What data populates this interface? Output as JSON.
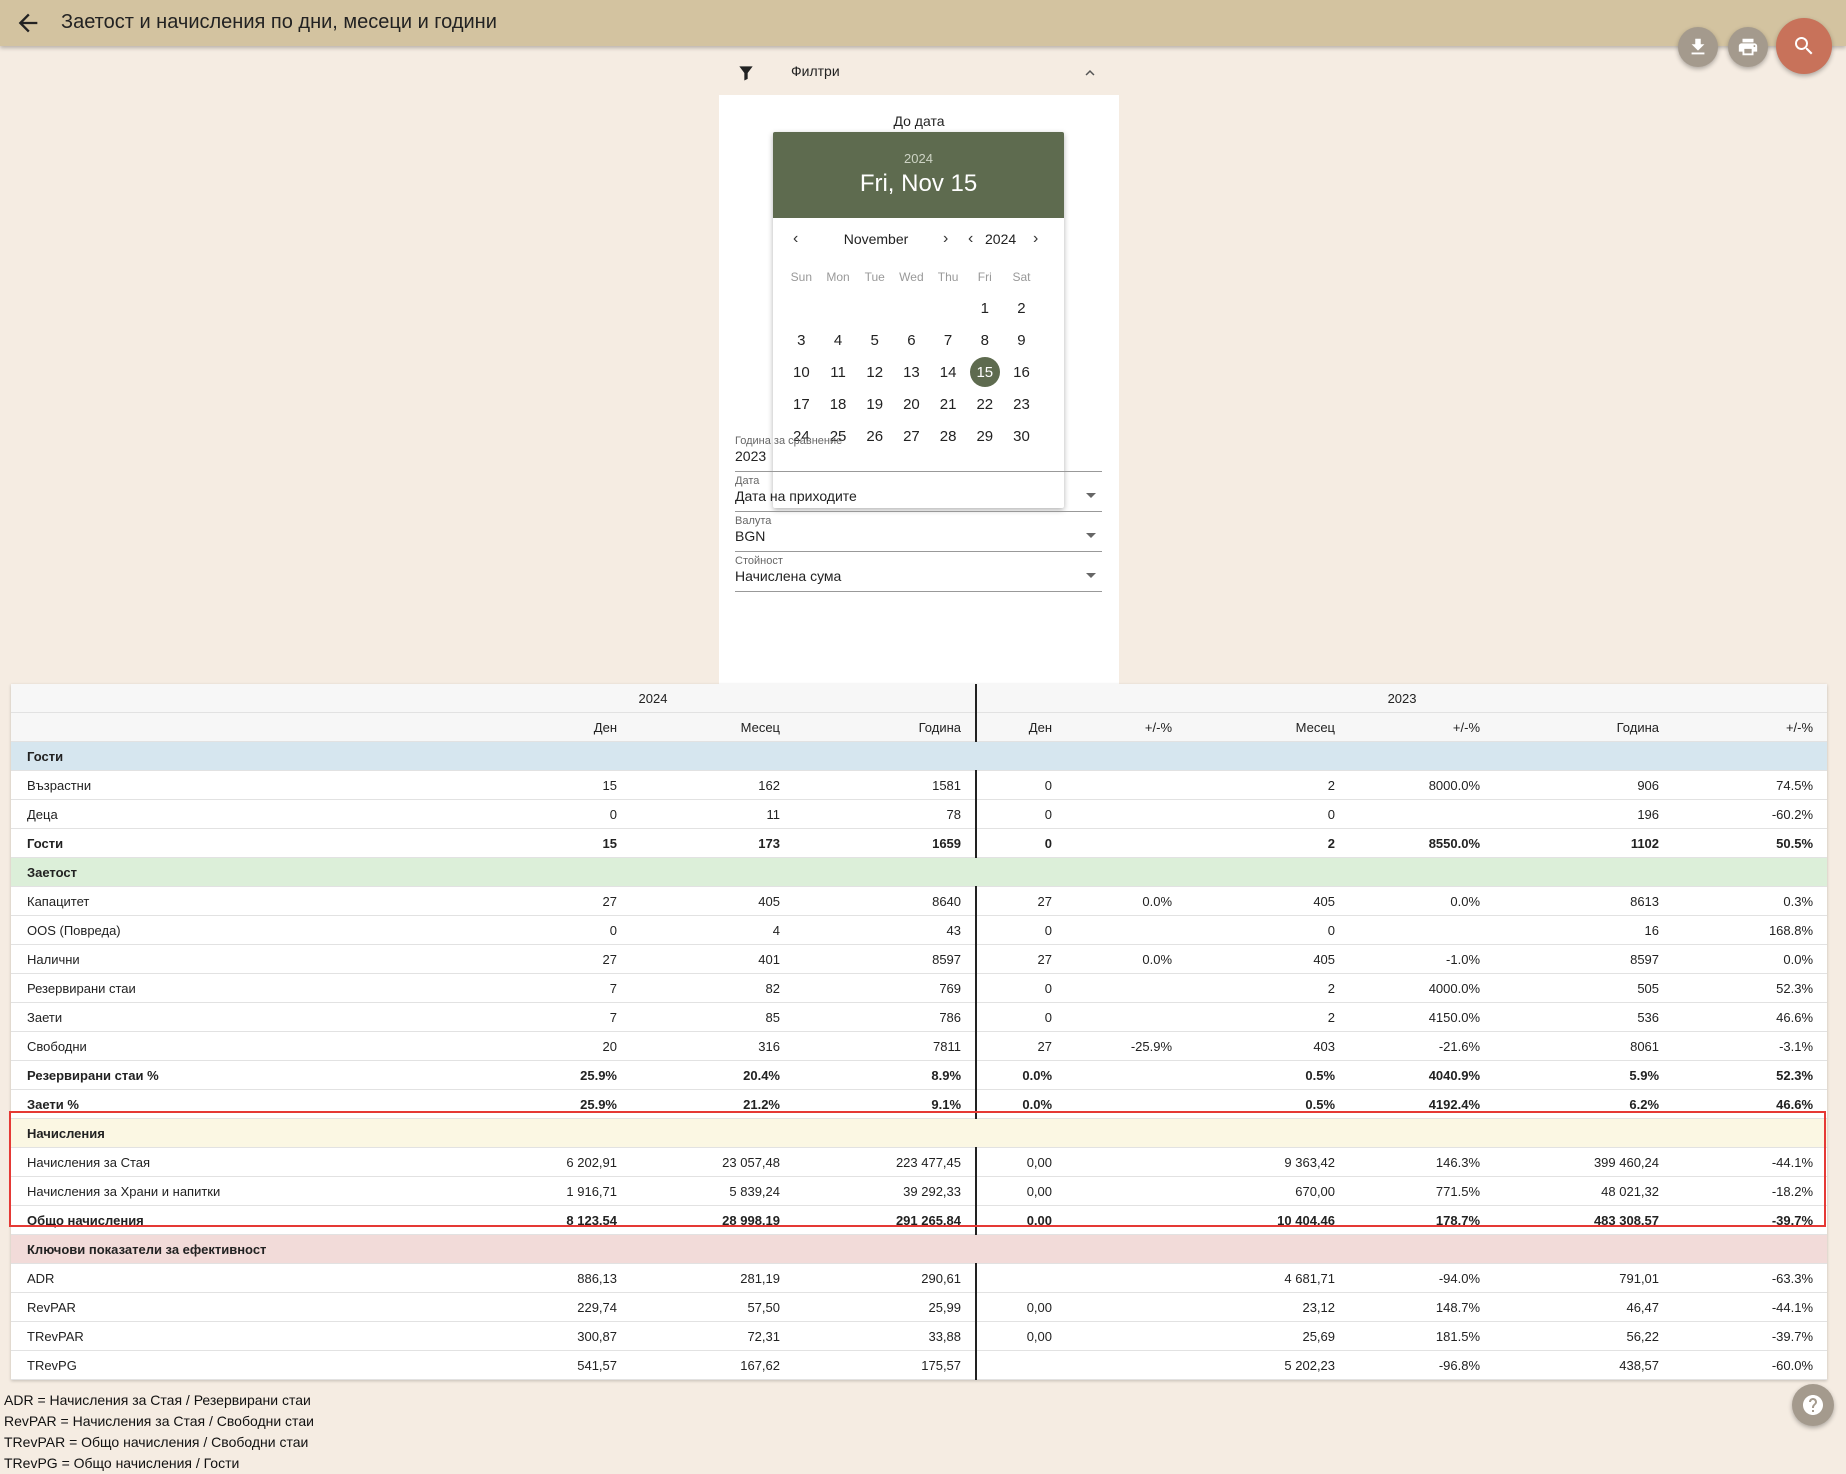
{
  "header": {
    "title": "Заетост и начисления по дни, месеци и години"
  },
  "filters": {
    "label": "Филтри",
    "date_label": "До дата",
    "calendar": {
      "year": "2024",
      "selected_display": "Fri, Nov 15",
      "month": "November",
      "nav_year": "2024",
      "weekdays": [
        "Sun",
        "Mon",
        "Tue",
        "Wed",
        "Thu",
        "Fri",
        "Sat"
      ],
      "selected_day": 15
    },
    "compare_year": {
      "label": "Година за сравнение",
      "value": "2023"
    },
    "date_field": {
      "label": "Дата",
      "value": "Дата на приходите"
    },
    "currency": {
      "label": "Валута",
      "value": "BGN"
    },
    "value_field": {
      "label": "Стойност",
      "value": "Начислена сума"
    }
  },
  "table": {
    "year_current": "2024",
    "year_compare": "2023",
    "columns": [
      "Ден",
      "Месец",
      "Година",
      "Ден",
      "+/-%",
      "Месец",
      "+/-%",
      "Година",
      "+/-%"
    ],
    "sections": [
      {
        "title": "Гости",
        "style": "guests",
        "rows": [
          {
            "name": "Възрастни",
            "bold": false,
            "values": [
              "15",
              "162",
              "1581",
              "0",
              "",
              "2",
              "8000.0%",
              "906",
              "74.5%"
            ]
          },
          {
            "name": "Деца",
            "bold": false,
            "values": [
              "0",
              "11",
              "78",
              "0",
              "",
              "0",
              "",
              "196",
              "-60.2%"
            ]
          },
          {
            "name": "Гости",
            "bold": true,
            "values": [
              "15",
              "173",
              "1659",
              "0",
              "",
              "2",
              "8550.0%",
              "1102",
              "50.5%"
            ]
          }
        ]
      },
      {
        "title": "Заетост",
        "style": "occ",
        "rows": [
          {
            "name": "Капацитет",
            "bold": false,
            "values": [
              "27",
              "405",
              "8640",
              "27",
              "0.0%",
              "405",
              "0.0%",
              "8613",
              "0.3%"
            ]
          },
          {
            "name": "OOS (Повреда)",
            "bold": false,
            "values": [
              "0",
              "4",
              "43",
              "0",
              "",
              "0",
              "",
              "16",
              "168.8%"
            ]
          },
          {
            "name": "Налични",
            "bold": false,
            "values": [
              "27",
              "401",
              "8597",
              "27",
              "0.0%",
              "405",
              "-1.0%",
              "8597",
              "0.0%"
            ]
          },
          {
            "name": "Резервирани стаи",
            "bold": false,
            "values": [
              "7",
              "82",
              "769",
              "0",
              "",
              "2",
              "4000.0%",
              "505",
              "52.3%"
            ]
          },
          {
            "name": "Заети",
            "bold": false,
            "values": [
              "7",
              "85",
              "786",
              "0",
              "",
              "2",
              "4150.0%",
              "536",
              "46.6%"
            ]
          },
          {
            "name": "Свободни",
            "bold": false,
            "values": [
              "20",
              "316",
              "7811",
              "27",
              "-25.9%",
              "403",
              "-21.6%",
              "8061",
              "-3.1%"
            ]
          },
          {
            "name": "Резервирани стаи %",
            "bold": true,
            "values": [
              "25.9%",
              "20.4%",
              "8.9%",
              "0.0%",
              "",
              "0.5%",
              "4040.9%",
              "5.9%",
              "52.3%"
            ]
          },
          {
            "name": "Заети %",
            "bold": true,
            "values": [
              "25.9%",
              "21.2%",
              "9.1%",
              "0.0%",
              "",
              "0.5%",
              "4192.4%",
              "6.2%",
              "46.6%"
            ]
          }
        ]
      },
      {
        "title": "Начисления",
        "style": "charges",
        "rows": [
          {
            "name": "Начисления за Стая",
            "bold": false,
            "values": [
              "6 202,91",
              "23 057,48",
              "223 477,45",
              "0,00",
              "",
              "9 363,42",
              "146.3%",
              "399 460,24",
              "-44.1%"
            ]
          },
          {
            "name": "Начисления за Храни и напитки",
            "bold": false,
            "values": [
              "1 916,71",
              "5 839,24",
              "39 292,33",
              "0,00",
              "",
              "670,00",
              "771.5%",
              "48 021,32",
              "-18.2%"
            ]
          },
          {
            "name": "Общо начисления",
            "bold": true,
            "values": [
              "8 123,54",
              "28 998,19",
              "291 265,84",
              "0,00",
              "",
              "10 404,46",
              "178.7%",
              "483 308,57",
              "-39.7%"
            ]
          }
        ]
      },
      {
        "title": "Ключови показатели за ефективност",
        "style": "kpi",
        "rows": [
          {
            "name": "ADR",
            "bold": false,
            "values": [
              "886,13",
              "281,19",
              "290,61",
              "",
              "",
              "4 681,71",
              "-94.0%",
              "791,01",
              "-63.3%"
            ]
          },
          {
            "name": "RevPAR",
            "bold": false,
            "values": [
              "229,74",
              "57,50",
              "25,99",
              "0,00",
              "",
              "23,12",
              "148.7%",
              "46,47",
              "-44.1%"
            ]
          },
          {
            "name": "TRevPAR",
            "bold": false,
            "values": [
              "300,87",
              "72,31",
              "33,88",
              "0,00",
              "",
              "25,69",
              "181.5%",
              "56,22",
              "-39.7%"
            ]
          },
          {
            "name": "TRevPG",
            "bold": false,
            "values": [
              "541,57",
              "167,62",
              "175,57",
              "",
              "",
              "5 202,23",
              "-96.8%",
              "438,57",
              "-60.0%"
            ]
          }
        ]
      }
    ]
  },
  "footnotes": [
    "ADR = Начисления за Стая / Резервирани стаи",
    "RevPAR = Начисления за Стая / Свободни стаи",
    "TRevPAR = Общо начисления / Свободни стаи",
    "TRevPG = Общо начисления / Гости"
  ],
  "colors": {
    "topbar": "#d3c3a0",
    "background": "#f5ece2",
    "calendar_accent": "#5e6b4f",
    "fab_primary": "#c8725a",
    "fab_secondary": "#a49a8d",
    "highlight": "#e53935"
  },
  "icons": {
    "back": "arrow-left-icon",
    "download": "download-icon",
    "print": "print-icon",
    "search": "search-icon",
    "filter": "filter-icon",
    "collapse": "chevron-up-icon",
    "help": "help-icon"
  }
}
